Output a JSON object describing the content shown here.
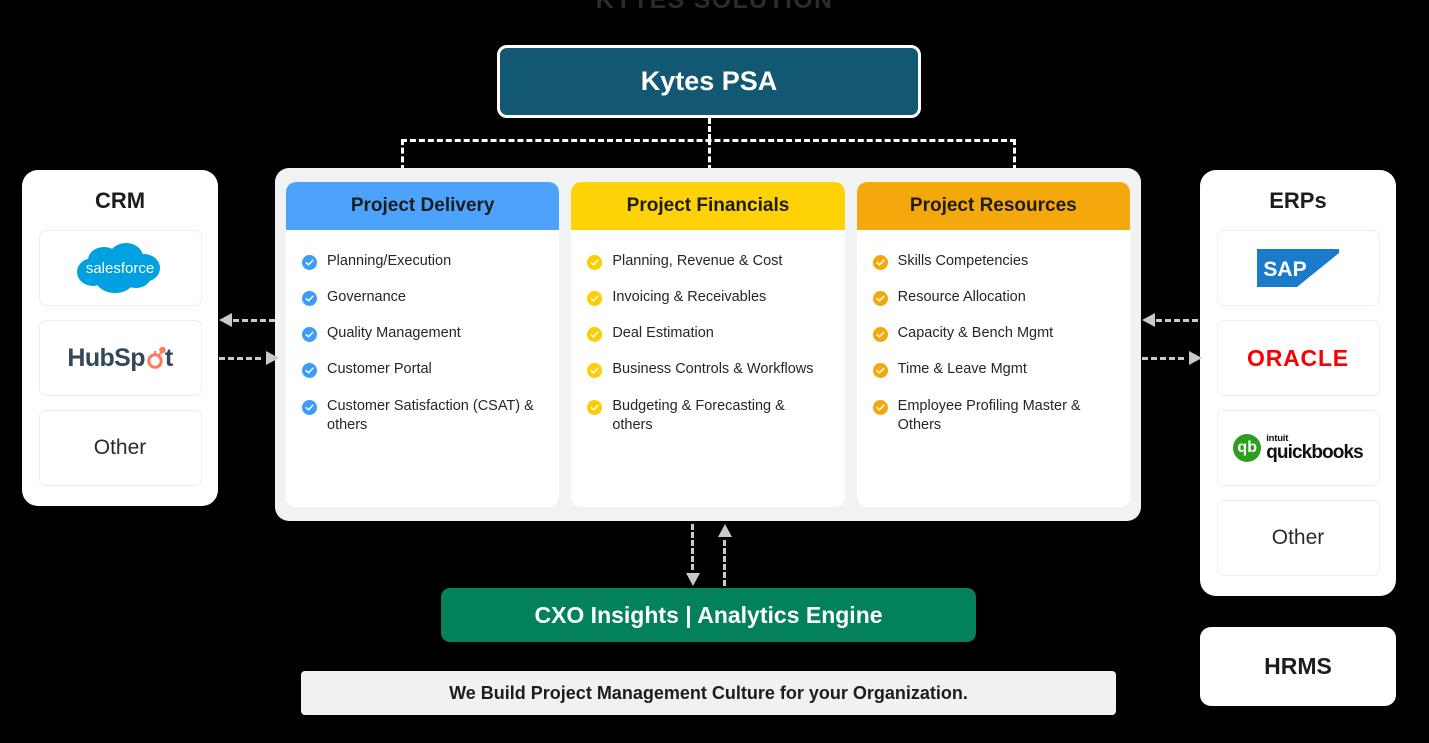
{
  "section_title": "KYTES SOLUTION",
  "psa": {
    "label": "Kytes PSA",
    "color": "#125873"
  },
  "left_panel": {
    "title": "CRM",
    "items": [
      {
        "name": "salesforce",
        "label": "salesforce",
        "type": "logo"
      },
      {
        "name": "hubspot",
        "label": "HubSpot",
        "type": "logo"
      },
      {
        "name": "other",
        "label": "Other",
        "type": "text"
      }
    ]
  },
  "right_panel": {
    "title": "ERPs",
    "items": [
      {
        "name": "sap",
        "label": "SAP",
        "type": "logo"
      },
      {
        "name": "oracle",
        "label": "ORACLE",
        "type": "logo"
      },
      {
        "name": "quickbooks",
        "label": "quickbooks",
        "sublabel": "intuit",
        "type": "logo"
      },
      {
        "name": "other",
        "label": "Other",
        "type": "text"
      }
    ]
  },
  "hrms": {
    "label": "HRMS"
  },
  "pillars": [
    {
      "title": "Project Delivery",
      "color": "#4da3fc",
      "tick_color": "#3d9bfb",
      "features": [
        "Planning/Execution",
        "Governance",
        "Quality Management",
        "Customer Portal",
        "Customer Satisfaction (CSAT) & others"
      ]
    },
    {
      "title": "Project Financials",
      "color": "#ffd207",
      "tick_color": "#ffcc00",
      "features": [
        "Planning, Revenue & Cost",
        "Invoicing & Receivables",
        "Deal Estimation",
        "Business Controls & Workflows",
        "Budgeting & Forecasting & others"
      ]
    },
    {
      "title": "Project Resources",
      "color": "#f5a80b",
      "tick_color": "#f5a80b",
      "features": [
        "Skills Competencies",
        "Resource Allocation",
        "Capacity & Bench Mgmt",
        "Time & Leave Mgmt",
        "Employee Profiling Master & Others"
      ]
    }
  ],
  "cxo": {
    "label": "CXO Insights | Analytics Engine",
    "color": "#03805c"
  },
  "tagline": {
    "label": "We Build Project Management Culture for your Organization."
  }
}
